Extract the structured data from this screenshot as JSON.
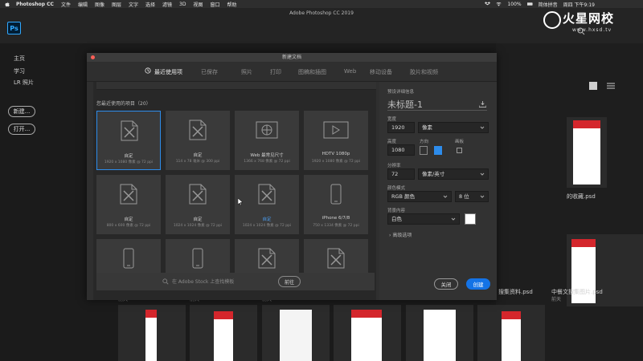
{
  "menubar": {
    "items": [
      "Photoshop CC",
      "文件",
      "编辑",
      "图像",
      "图层",
      "文字",
      "选择",
      "滤镜",
      "3D",
      "视图",
      "窗口",
      "帮助"
    ],
    "battery": "100%",
    "ime": "简体拼音",
    "clock": "周四 下午9:19"
  },
  "appbar": {
    "title": "Adobe Photoshop CC 2019",
    "logo": "Ps"
  },
  "watermark": {
    "text": "火星网校",
    "url": "www.hxsd.tv"
  },
  "leftnav": {
    "items": [
      "主页",
      "学习",
      "LR 照片"
    ],
    "new_button": "新建...",
    "open_button": "打开..."
  },
  "dialog": {
    "title": "新建文档",
    "tabs": [
      "最近使用项",
      "已保存",
      "照片",
      "打印",
      "图稿和插图",
      "Web",
      "移动设备",
      "胶片和视频"
    ],
    "active_tab": "最近使用项",
    "section_title": "您最近使用的项目（20）",
    "cards": [
      {
        "label": "自定",
        "size": "1920 x 1080 像素 @ 72 ppi",
        "icon": "custom-doc-icon",
        "selected": true
      },
      {
        "label": "自定",
        "size": "114 x 78 毫米 @ 300 ppi",
        "icon": "custom-doc-icon"
      },
      {
        "label": "Web 最常见尺寸",
        "size": "1366 x 768 像素 @ 72 ppi",
        "icon": "web-icon"
      },
      {
        "label": "HDTV 1080p",
        "size": "1920 x 1080 像素 @ 72 ppi",
        "icon": "video-icon"
      },
      {
        "label": "自定",
        "size": "800 x 600 像素 @ 72 ppi",
        "icon": "custom-doc-icon"
      },
      {
        "label": "自定",
        "size": "1024 x 1024 像素 @ 72 ppi",
        "icon": "custom-doc-icon"
      },
      {
        "label": "自定",
        "size": "1024 x 1024 像素 @ 72 ppi",
        "icon": "custom-doc-icon",
        "hover": true
      },
      {
        "label": "iPhone 6/7/8",
        "size": "750 x 1334 像素 @ 72 ppi",
        "icon": "phone-icon"
      },
      {
        "label": "",
        "size": "",
        "icon": "phone-icon"
      },
      {
        "label": "",
        "size": "",
        "icon": "phone-icon"
      },
      {
        "label": "",
        "size": "",
        "icon": "custom-doc-icon"
      },
      {
        "label": "",
        "size": "",
        "icon": "custom-doc-icon"
      }
    ],
    "stock_placeholder": "在 Adobe Stock 上查找模板",
    "stock_go": "前往",
    "settings": {
      "header": "预设详细信息",
      "doc_name": "未标题-1",
      "width_label": "宽度",
      "width_value": "1920",
      "unit": "像素",
      "height_label": "高度",
      "height_value": "1080",
      "orientation_label": "方向",
      "artboard_label": "画板",
      "resolution_label": "分辨率",
      "resolution_value": "72",
      "resolution_unit": "像素/英寸",
      "color_mode_label": "颜色模式",
      "color_mode": "RGB 颜色",
      "bit_depth": "8 位",
      "bg_label": "背景内容",
      "bg_value": "白色",
      "advanced": "高级选项",
      "close": "关闭",
      "create": "创建"
    }
  },
  "background": {
    "file1": "的收藏.psd",
    "file1_sub": "前天",
    "file2": "中餐文搜集图片.psd",
    "file2_sub": "前天",
    "file3": "搜集资料.psd",
    "sub_left1": "前天",
    "sub_left2": "前天",
    "sub_left3": "前天"
  },
  "colors": {
    "accent": "#1473e6",
    "selected_border": "#2d8ceb",
    "brand_red": "#d4262c"
  }
}
